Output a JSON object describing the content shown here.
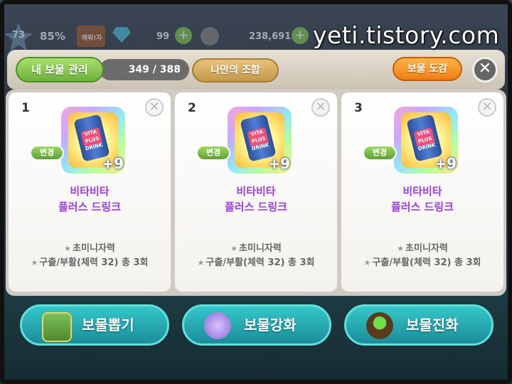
{
  "hud": {
    "level": "73",
    "percent": "85%",
    "box_label": "깨워!자",
    "gem_count": "99",
    "gold_count": "238,691",
    "plus": "+"
  },
  "watermark": "yeti.tistory.com",
  "top": {
    "my_treasure_label": "내 보물 관리",
    "count": "349 / 388",
    "combo_label": "나만의 조합",
    "book_label": "보물 도감",
    "close_label": "✕"
  },
  "slots": [
    {
      "num": "1",
      "name_line1": "비타비타",
      "name_line2": "플러스 드링크",
      "change": "변경",
      "plus": "+9",
      "can_text": "VITA PLUS DRINK",
      "effect1": "초미니자력",
      "effect2": "구출/부활(체력 32) 총 3회"
    },
    {
      "num": "2",
      "name_line1": "비타비타",
      "name_line2": "플러스 드링크",
      "change": "변경",
      "plus": "+9",
      "can_text": "VITA PLUS DRINK",
      "effect1": "초미니자력",
      "effect2": "구출/부활(체력 32) 총 3회"
    },
    {
      "num": "3",
      "name_line1": "비타비타",
      "name_line2": "플러스 드링크",
      "change": "변경",
      "plus": "+9",
      "can_text": "VITA PLUS DRINK",
      "effect1": "초미니자력",
      "effect2": "구출/부활(체력 32) 총 3회"
    }
  ],
  "remove_glyph": "✕",
  "star_glyph": "★",
  "bottom": {
    "draw_label": "보물뽑기",
    "enhance_label": "보물강화",
    "evolve_label": "보물진화"
  },
  "icons": [
    "star-level-icon",
    "treasure-box-icon",
    "gem-icon",
    "plus-icon",
    "friend-face-icon",
    "close-icon",
    "remove-icon",
    "drink-can-icon",
    "chest-icon",
    "magic-orb-icon",
    "cauldron-icon"
  ]
}
